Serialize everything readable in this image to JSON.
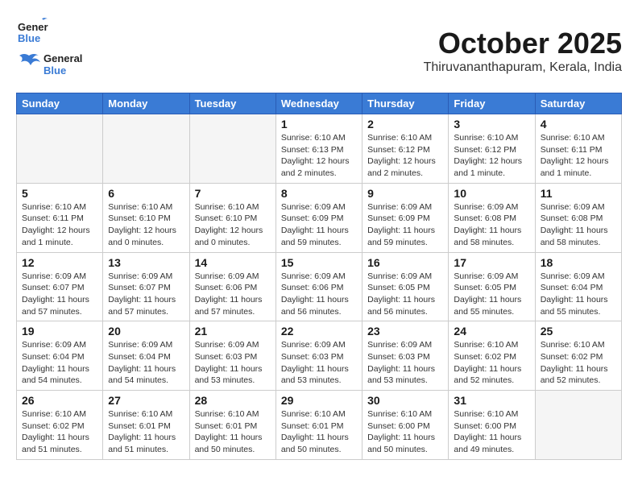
{
  "header": {
    "logo_line1": "General",
    "logo_line2": "Blue",
    "month": "October 2025",
    "location": "Thiruvananthapuram, Kerala, India"
  },
  "days_of_week": [
    "Sunday",
    "Monday",
    "Tuesday",
    "Wednesday",
    "Thursday",
    "Friday",
    "Saturday"
  ],
  "weeks": [
    [
      {
        "day": "",
        "info": ""
      },
      {
        "day": "",
        "info": ""
      },
      {
        "day": "",
        "info": ""
      },
      {
        "day": "1",
        "info": "Sunrise: 6:10 AM\nSunset: 6:13 PM\nDaylight: 12 hours\nand 2 minutes."
      },
      {
        "day": "2",
        "info": "Sunrise: 6:10 AM\nSunset: 6:12 PM\nDaylight: 12 hours\nand 2 minutes."
      },
      {
        "day": "3",
        "info": "Sunrise: 6:10 AM\nSunset: 6:12 PM\nDaylight: 12 hours\nand 1 minute."
      },
      {
        "day": "4",
        "info": "Sunrise: 6:10 AM\nSunset: 6:11 PM\nDaylight: 12 hours\nand 1 minute."
      }
    ],
    [
      {
        "day": "5",
        "info": "Sunrise: 6:10 AM\nSunset: 6:11 PM\nDaylight: 12 hours\nand 1 minute."
      },
      {
        "day": "6",
        "info": "Sunrise: 6:10 AM\nSunset: 6:10 PM\nDaylight: 12 hours\nand 0 minutes."
      },
      {
        "day": "7",
        "info": "Sunrise: 6:10 AM\nSunset: 6:10 PM\nDaylight: 12 hours\nand 0 minutes."
      },
      {
        "day": "8",
        "info": "Sunrise: 6:09 AM\nSunset: 6:09 PM\nDaylight: 11 hours\nand 59 minutes."
      },
      {
        "day": "9",
        "info": "Sunrise: 6:09 AM\nSunset: 6:09 PM\nDaylight: 11 hours\nand 59 minutes."
      },
      {
        "day": "10",
        "info": "Sunrise: 6:09 AM\nSunset: 6:08 PM\nDaylight: 11 hours\nand 58 minutes."
      },
      {
        "day": "11",
        "info": "Sunrise: 6:09 AM\nSunset: 6:08 PM\nDaylight: 11 hours\nand 58 minutes."
      }
    ],
    [
      {
        "day": "12",
        "info": "Sunrise: 6:09 AM\nSunset: 6:07 PM\nDaylight: 11 hours\nand 57 minutes."
      },
      {
        "day": "13",
        "info": "Sunrise: 6:09 AM\nSunset: 6:07 PM\nDaylight: 11 hours\nand 57 minutes."
      },
      {
        "day": "14",
        "info": "Sunrise: 6:09 AM\nSunset: 6:06 PM\nDaylight: 11 hours\nand 57 minutes."
      },
      {
        "day": "15",
        "info": "Sunrise: 6:09 AM\nSunset: 6:06 PM\nDaylight: 11 hours\nand 56 minutes."
      },
      {
        "day": "16",
        "info": "Sunrise: 6:09 AM\nSunset: 6:05 PM\nDaylight: 11 hours\nand 56 minutes."
      },
      {
        "day": "17",
        "info": "Sunrise: 6:09 AM\nSunset: 6:05 PM\nDaylight: 11 hours\nand 55 minutes."
      },
      {
        "day": "18",
        "info": "Sunrise: 6:09 AM\nSunset: 6:04 PM\nDaylight: 11 hours\nand 55 minutes."
      }
    ],
    [
      {
        "day": "19",
        "info": "Sunrise: 6:09 AM\nSunset: 6:04 PM\nDaylight: 11 hours\nand 54 minutes."
      },
      {
        "day": "20",
        "info": "Sunrise: 6:09 AM\nSunset: 6:04 PM\nDaylight: 11 hours\nand 54 minutes."
      },
      {
        "day": "21",
        "info": "Sunrise: 6:09 AM\nSunset: 6:03 PM\nDaylight: 11 hours\nand 53 minutes."
      },
      {
        "day": "22",
        "info": "Sunrise: 6:09 AM\nSunset: 6:03 PM\nDaylight: 11 hours\nand 53 minutes."
      },
      {
        "day": "23",
        "info": "Sunrise: 6:09 AM\nSunset: 6:03 PM\nDaylight: 11 hours\nand 53 minutes."
      },
      {
        "day": "24",
        "info": "Sunrise: 6:10 AM\nSunset: 6:02 PM\nDaylight: 11 hours\nand 52 minutes."
      },
      {
        "day": "25",
        "info": "Sunrise: 6:10 AM\nSunset: 6:02 PM\nDaylight: 11 hours\nand 52 minutes."
      }
    ],
    [
      {
        "day": "26",
        "info": "Sunrise: 6:10 AM\nSunset: 6:02 PM\nDaylight: 11 hours\nand 51 minutes."
      },
      {
        "day": "27",
        "info": "Sunrise: 6:10 AM\nSunset: 6:01 PM\nDaylight: 11 hours\nand 51 minutes."
      },
      {
        "day": "28",
        "info": "Sunrise: 6:10 AM\nSunset: 6:01 PM\nDaylight: 11 hours\nand 50 minutes."
      },
      {
        "day": "29",
        "info": "Sunrise: 6:10 AM\nSunset: 6:01 PM\nDaylight: 11 hours\nand 50 minutes."
      },
      {
        "day": "30",
        "info": "Sunrise: 6:10 AM\nSunset: 6:00 PM\nDaylight: 11 hours\nand 50 minutes."
      },
      {
        "day": "31",
        "info": "Sunrise: 6:10 AM\nSunset: 6:00 PM\nDaylight: 11 hours\nand 49 minutes."
      },
      {
        "day": "",
        "info": ""
      }
    ]
  ]
}
